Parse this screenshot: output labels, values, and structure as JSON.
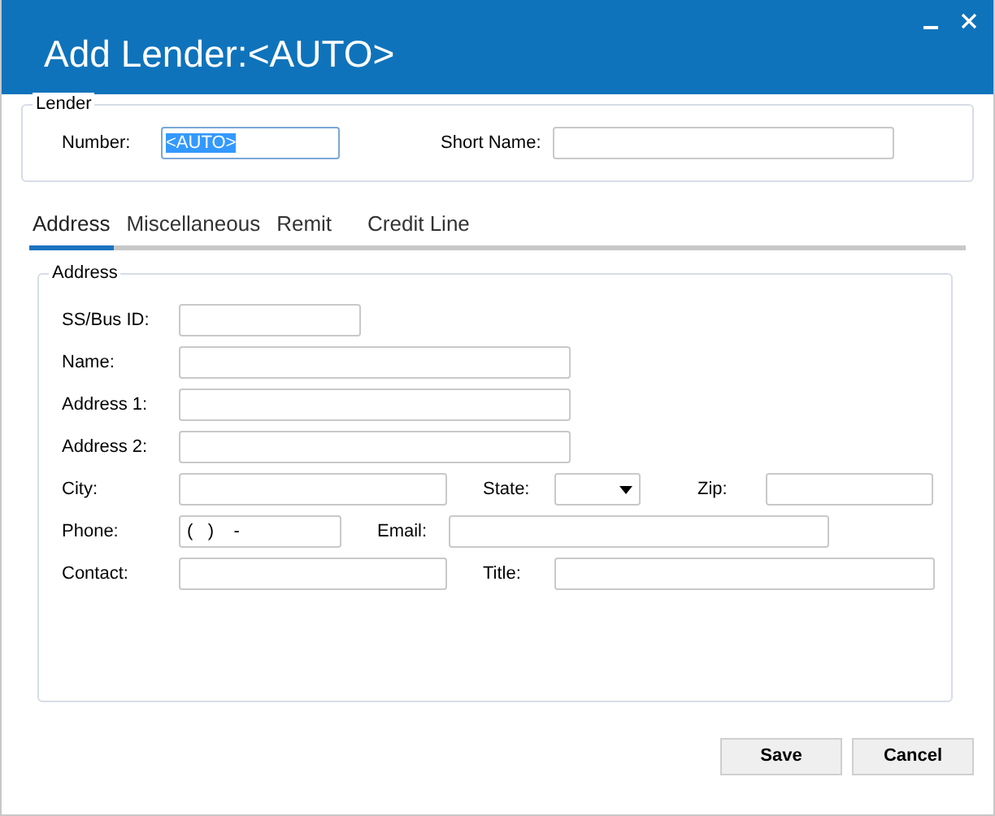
{
  "window": {
    "title": "Add Lender:<AUTO>"
  },
  "lender": {
    "legend": "Lender",
    "number_label": "Number:",
    "number_value": "<AUTO>",
    "number_selected": true,
    "short_name_label": "Short Name:"
  },
  "tabs": [
    {
      "label": "Address",
      "selected": true
    },
    {
      "label": "Miscellaneous",
      "selected": false
    },
    {
      "label": "Remit",
      "selected": false
    },
    {
      "label": "Credit Line",
      "selected": false
    }
  ],
  "address": {
    "legend": "Address",
    "rows": [
      [
        {
          "label": "SS/Bus ID:",
          "kind": "text"
        }
      ],
      [
        {
          "label": "Name:",
          "kind": "text"
        }
      ],
      [
        {
          "label": "Address 1:",
          "kind": "text"
        }
      ],
      [
        {
          "label": "Address 2:",
          "kind": "text"
        }
      ],
      [
        {
          "label": "City:",
          "kind": "text"
        },
        {
          "label": "State:",
          "kind": "dropdown"
        },
        {
          "label": "Zip:",
          "kind": "text"
        }
      ],
      [
        {
          "label": "Phone:",
          "kind": "text",
          "value": "(   )    -"
        },
        {
          "label": "Email:",
          "kind": "text"
        }
      ],
      [
        {
          "label": "Contact:",
          "kind": "text"
        },
        {
          "label": "Title:",
          "kind": "text"
        }
      ]
    ]
  },
  "buttons": [
    "Save",
    "Cancel"
  ]
}
